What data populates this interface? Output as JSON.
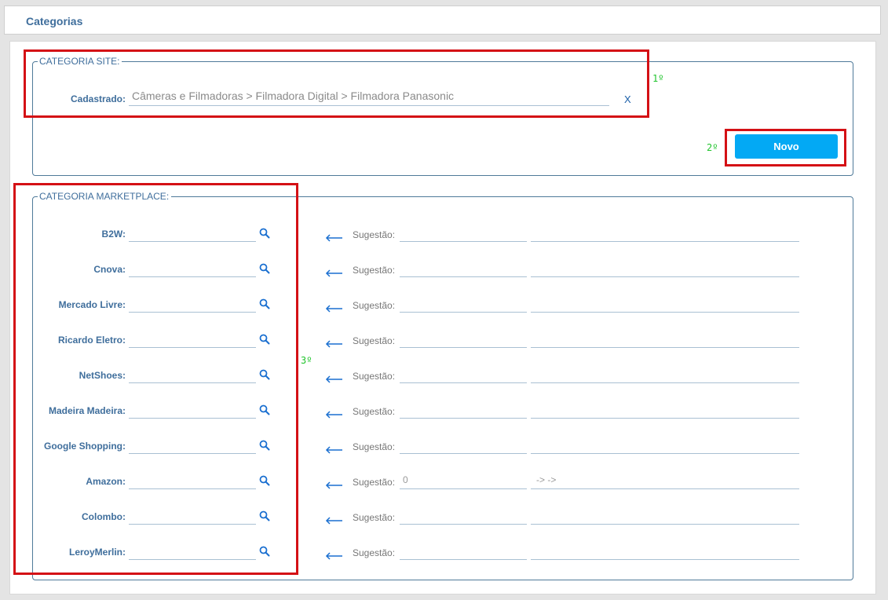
{
  "header": {
    "title": "Categorias"
  },
  "categoria_site": {
    "legend": "CATEGORIA SITE:",
    "label": "Cadastrado:",
    "value": "Câmeras e Filmadoras > Filmadora Digital > Filmadora Panasonic",
    "clear": "X",
    "button": "Novo"
  },
  "categoria_marketplace": {
    "legend": "CATEGORIA MARKETPLACE:",
    "suggestion_label": "Sugestão:",
    "rows": [
      {
        "label": "B2W:",
        "sugg_code": "",
        "sugg_path": ""
      },
      {
        "label": "Cnova:",
        "sugg_code": "",
        "sugg_path": ""
      },
      {
        "label": "Mercado Livre:",
        "sugg_code": "",
        "sugg_path": ""
      },
      {
        "label": "Ricardo Eletro:",
        "sugg_code": "",
        "sugg_path": ""
      },
      {
        "label": "NetShoes:",
        "sugg_code": "",
        "sugg_path": ""
      },
      {
        "label": "Madeira Madeira:",
        "sugg_code": "",
        "sugg_path": ""
      },
      {
        "label": "Google Shopping:",
        "sugg_code": "",
        "sugg_path": ""
      },
      {
        "label": "Amazon:",
        "sugg_code": "0",
        "sugg_path": "-> ->"
      },
      {
        "label": "Colombo:",
        "sugg_code": "",
        "sugg_path": ""
      },
      {
        "label": "LeroyMerlin:",
        "sugg_code": "",
        "sugg_path": ""
      }
    ]
  },
  "annotations": {
    "first": "1º",
    "second": "2º",
    "third": "3º"
  },
  "colors": {
    "accent": "#03a9f4",
    "label": "#3f6e9c",
    "highlight": "#d41015",
    "note": "#21c42d"
  }
}
